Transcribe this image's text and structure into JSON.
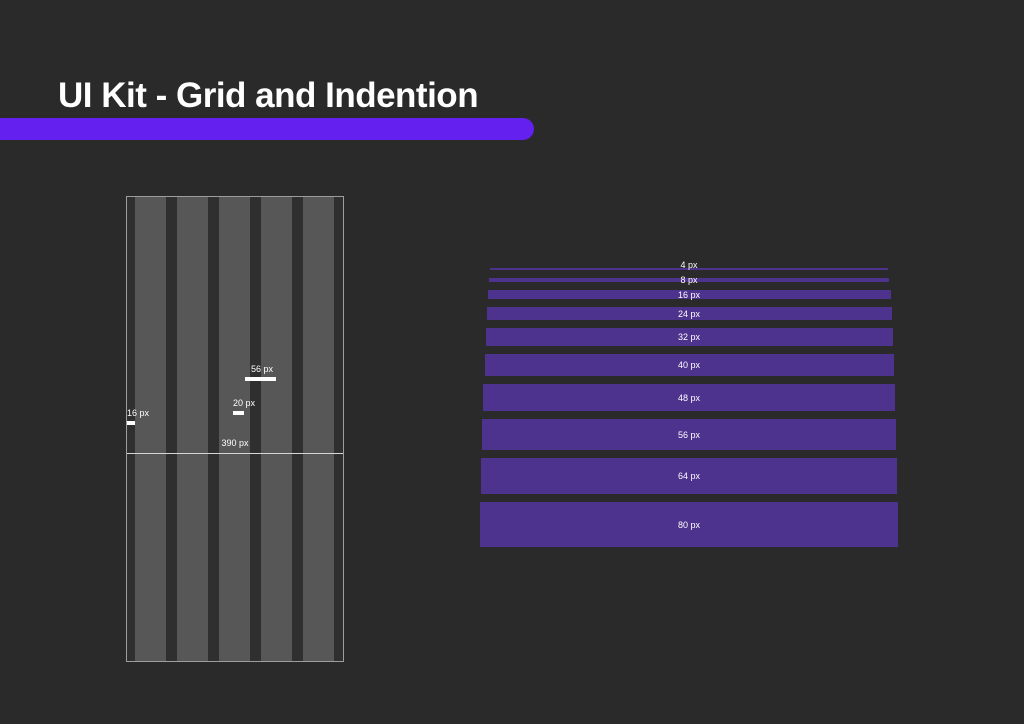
{
  "title": "UI Kit - Grid and Indention",
  "colors": {
    "accent": "#6320ee",
    "bar": "#4d328e",
    "bg": "#2a2a2a"
  },
  "grid": {
    "width_label": "390 px",
    "margin_label": "16 px",
    "gutter_label": "20 px",
    "col_label": "56 px"
  },
  "scale": {
    "s4": "4 px",
    "s8": "8 px",
    "s16": "16 px",
    "s24": "24 px",
    "s32": "32 px",
    "s40": "40 px",
    "s48": "48 px",
    "s56": "56 px",
    "s64": "64 px",
    "s80": "80 px"
  }
}
